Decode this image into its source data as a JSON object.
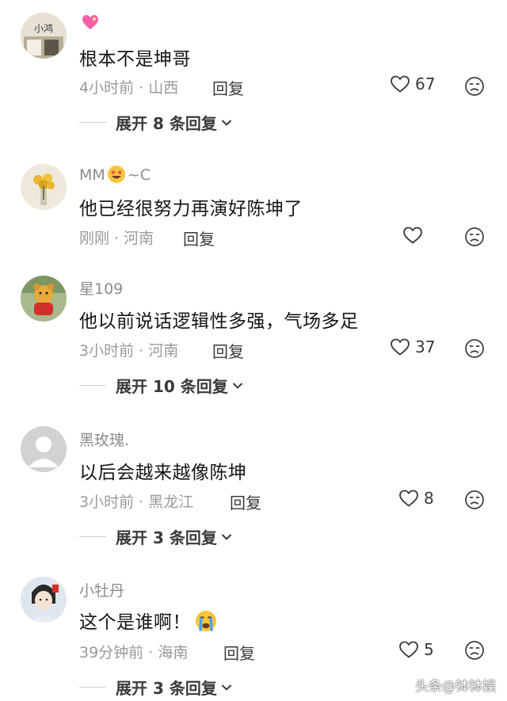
{
  "comments": [
    {
      "username": "",
      "username_emoji": "sparkling-heart",
      "text": "根本不是坤哥",
      "time": "4小时前",
      "location": "山西",
      "reply_label": "回复",
      "likes": "67",
      "expand_label": "展开 8 条回复"
    },
    {
      "username_prefix": "MM",
      "username_emoji": "star-struck-face",
      "username_suffix": "~C",
      "text": "他已经很努力再演好陈坤了",
      "time": "刚刚",
      "location": "河南",
      "reply_label": "回复",
      "likes": ""
    },
    {
      "username": "星109",
      "text": "他以前说话逻辑性多强，气场多足",
      "time": "3小时前",
      "location": "河南",
      "reply_label": "回复",
      "likes": "37",
      "expand_label": "展开 10 条回复"
    },
    {
      "username": "黑玫瑰.",
      "text": "以后会越来越像陈坤",
      "time": "3小时前",
      "location": "黑龙江",
      "reply_label": "回复",
      "likes": "8",
      "expand_label": "展开 3 条回复"
    },
    {
      "username": "小牡丹",
      "text": "这个是谁啊！",
      "text_emoji": "crying-face",
      "time": "39分钟前",
      "location": "海南",
      "reply_label": "回复",
      "likes": "5",
      "expand_label": "展开 3 条回复"
    }
  ],
  "meta_separator": "·",
  "watermark": "头条@钵钵娱"
}
